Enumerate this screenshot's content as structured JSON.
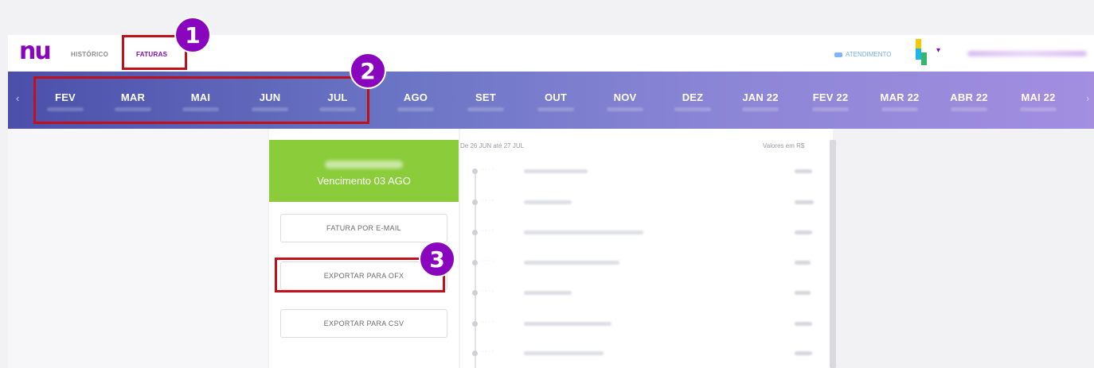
{
  "header": {
    "logo": "nu",
    "nav": [
      {
        "label": "HISTÓRICO"
      },
      {
        "label": "FATURAS"
      }
    ],
    "support_label": "ATENDIMENTO",
    "brand_colors": [
      "#f6c800",
      "#1fb5e8",
      "#33b86b"
    ]
  },
  "months": {
    "items": [
      {
        "label": "FEV"
      },
      {
        "label": "MAR"
      },
      {
        "label": "MAI"
      },
      {
        "label": "JUN"
      },
      {
        "label": "JUL"
      },
      {
        "label": "AGO"
      },
      {
        "label": "SET"
      },
      {
        "label": "OUT"
      },
      {
        "label": "NOV"
      },
      {
        "label": "DEZ"
      },
      {
        "label": "JAN 22"
      },
      {
        "label": "FEV 22"
      },
      {
        "label": "MAR 22"
      },
      {
        "label": "ABR 22"
      },
      {
        "label": "MAI 22"
      }
    ],
    "prev_icon": "chevron-left-icon",
    "next_icon": "chevron-right-icon"
  },
  "bill": {
    "due_text": "Vencimento 03 AGO",
    "accent_color": "#8bcc3a",
    "actions": {
      "email": "FATURA POR E-MAIL",
      "ofx": "EXPORTAR PARA OFX",
      "csv": "EXPORTAR PARA CSV"
    }
  },
  "transactions": {
    "period": "De 26 JUN até 27 JUL",
    "currency_note": "Valores em R$"
  },
  "annotations": {
    "badges": [
      "1",
      "2",
      "3"
    ],
    "highlight_color": "#c0101a",
    "badge_color": "#8a05be"
  }
}
